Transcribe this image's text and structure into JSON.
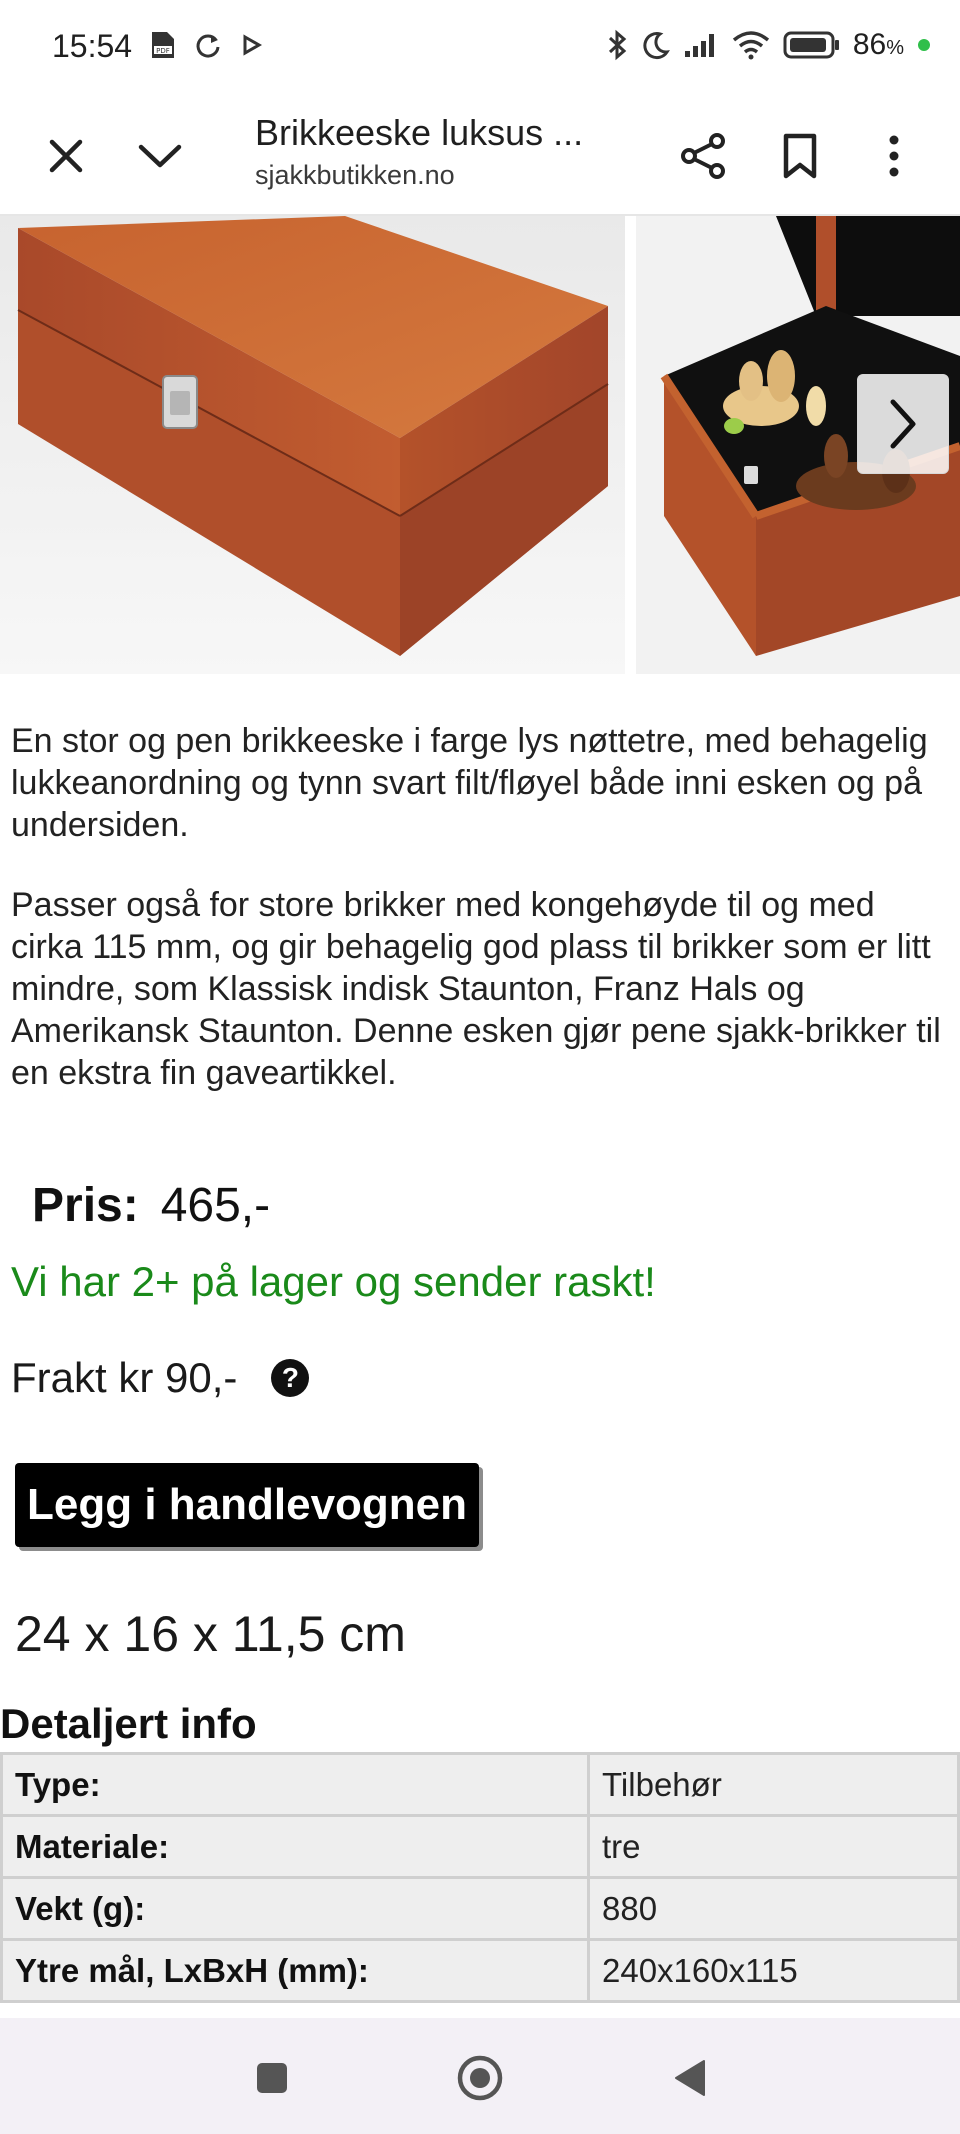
{
  "status_bar": {
    "time": "15:54",
    "battery": "86",
    "battery_unit": "%",
    "battery_dot_color": "#2fbf4a",
    "icons": [
      "pdf-icon",
      "sync-icon",
      "play-icon",
      "bluetooth-icon",
      "moon-icon",
      "signal-icon",
      "wifi-icon",
      "battery-icon"
    ]
  },
  "toolbar": {
    "title": "Brikkeeske luksus ...",
    "url": "sjakkbutikken.no",
    "icons": [
      "close-icon",
      "chevron-down-icon",
      "share-icon",
      "bookmark-icon",
      "more-vert-icon"
    ]
  },
  "gallery": {
    "images": [
      "wooden-box-closed",
      "wooden-box-open-with-chess-pieces"
    ],
    "next_icon": "chevron-right-icon"
  },
  "product": {
    "description_1": "En stor og pen brikkeeske i farge lys nøttetre, med behagelig lukkeanordning og tynn svart filt/fløyel både inni esken og på undersiden.",
    "description_2": "Passer også for store brikker med kongehøyde til og med cirka 115 mm, og gir behagelig god plass til brikker som er litt mindre, som Klassisk indisk Staunton, Franz Hals og Amerikansk Staunton. Denne esken gjør pene sjakk-brikker til en ekstra fin gaveartikkel.",
    "price_label": "Pris:",
    "price_value": "465,-",
    "stock": "Vi har 2+ på lager og sender raskt!",
    "stock_color": "#1a8a1a",
    "shipping": "Frakt kr 90,-",
    "help_glyph": "?",
    "cart_button": "Legg i handlevognen",
    "dimensions": "24 x 16 x 11,5 cm"
  },
  "details": {
    "title": "Detaljert info",
    "rows": [
      {
        "key": "Type:",
        "value": "Tilbehør"
      },
      {
        "key": "Materiale:",
        "value": "tre"
      },
      {
        "key": "Vekt (g):",
        "value": "880"
      },
      {
        "key": "Ytre mål, LxBxH (mm):",
        "value": "240x160x115"
      }
    ]
  },
  "nav_bar": {
    "icons": [
      "recents-square-icon",
      "home-circle-icon",
      "back-triangle-icon"
    ]
  }
}
